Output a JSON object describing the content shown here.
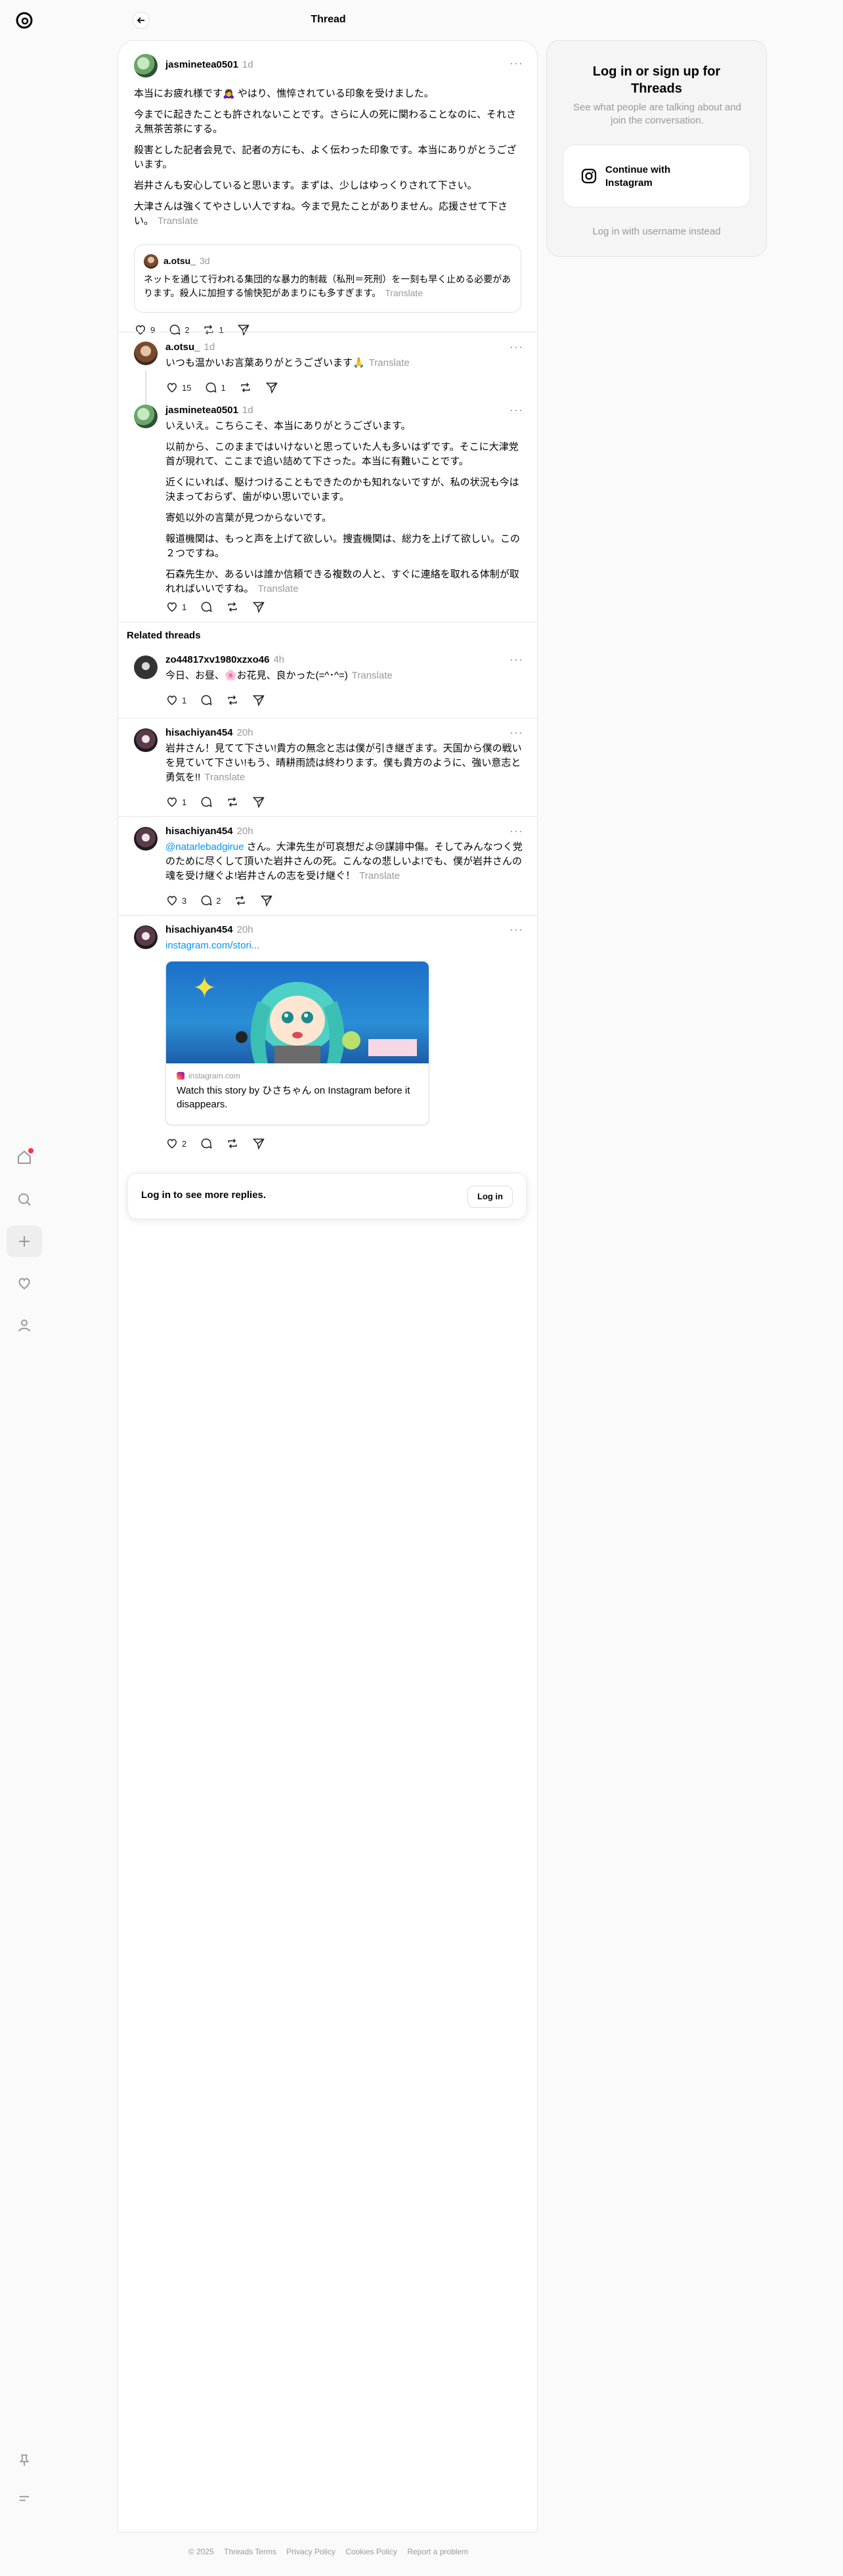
{
  "header": {
    "title": "Thread",
    "back_label": "Back"
  },
  "nav": {
    "items": [
      "home-icon",
      "search-icon",
      "create-icon",
      "activity-icon",
      "profile-icon"
    ],
    "bottom": [
      "pin-icon",
      "menu-icon"
    ]
  },
  "main_post": {
    "username": "jasminetea0501",
    "time": "1d",
    "paragraphs": [
      "本当にお疲れ様です🙇‍♀️ やはり、憔悴されている印象を受けました。",
      "今までに起きたことも許されないことです。さらに人の死に関わることなのに、それさえ無茶苦茶にする。",
      "殺害とした記者会見で、記者の方にも、よく伝わった印象です。本当にありがとうございます。",
      "岩井さんも安心していると思います。まずは、少しはゆっくりされて下さい。",
      "大津さんは強くてやさしい人ですね。今まで見たことがありません。応援させて下さい。"
    ],
    "translate": "Translate",
    "quote": {
      "username": "a.otsu_",
      "time": "3d",
      "text": "ネットを通じて行われる集団的な暴力的制裁（私刑＝死刑）を一刻も早く止める必要があります。殺人に加担する愉快犯があまりにも多すぎます。",
      "translate": "Translate"
    },
    "likes": "9",
    "replies": "2",
    "reposts": "1"
  },
  "reply1": {
    "username": "a.otsu_",
    "time": "1d",
    "text": "いつも温かいお言葉ありがとうございます🙏",
    "translate": "Translate",
    "likes": "15",
    "replies": "1"
  },
  "reply2": {
    "username": "jasminetea0501",
    "time": "1d",
    "paragraphs": [
      "いえいえ。こちらこそ、本当にありがとうございます。",
      "以前から、このままではいけないと思っていた人も多いはずです。そこに大津党首が現れて、ここまで追い詰めて下さった。本当に有難いことです。",
      "近くにいれば、駆けつけることもできたのかも知れないですが、私の状況も今は決まっておらず、歯がゆい思いでいます。",
      "寄処以外の言葉が見つからないです。",
      "報道機関は、もっと声を上げて欲しい。捜査機関は、総力を上げて欲しい。この２つですね。",
      "石森先生か、あるいは誰か信頼できる複数の人と、すぐに連絡を取れる体制が取れればいいですね。"
    ],
    "translate": "Translate",
    "likes": "1"
  },
  "related": {
    "title": "Related threads",
    "threads": [
      {
        "username": "zo44817xv1980xzxo46",
        "time": "4h",
        "text": "今日、お昼、🌸お花見、良かった(=^･^=)",
        "translate": "Translate",
        "likes": "1",
        "replies": ""
      },
      {
        "username": "hisachiyan454",
        "time": "20h",
        "text": "岩井さん！見てて下さい!貴方の無念と志は僕が引き継ぎます。天国から僕の戦いを見ていて下さい!もう、晴耕雨読は終わります。僕も貴方のように、強い意志と勇気を!!",
        "translate": "Translate",
        "likes": "1",
        "replies": ""
      },
      {
        "username": "hisachiyan454",
        "time": "20h",
        "mention": "@natarlebadgirue",
        "text": " さん。大津先生が可哀想だよ😢謀誹中傷。そしてみんなつく党のために尽くして頂いた岩井さんの死。こんなの悲しいよ!でも、僕が岩井さんの魂を受け継ぐよ!岩井さんの志を受け継ぐ！",
        "translate": "Translate",
        "likes": "3",
        "replies": "2"
      },
      {
        "username": "hisachiyan454",
        "time": "20h",
        "link": "instagram.com/stori...",
        "card_source": "instagram.com",
        "card_text": "Watch this story by ひさちゃん on Instagram before it disappears.",
        "likes": "2",
        "replies": ""
      }
    ]
  },
  "login_bar": {
    "text": "Log in to see more replies.",
    "button": "Log in"
  },
  "side": {
    "title": "Log in or sign up for Threads",
    "subtitle": "See what people are talking about and join the conversation.",
    "ig_button": "Continue with Instagram",
    "alt": "Log in with username instead"
  },
  "footer": {
    "links": [
      "© 2025",
      "Threads Terms",
      "Privacy Policy",
      "Cookies Policy",
      "Report a problem"
    ]
  },
  "colors": {
    "link": "#0095f6",
    "muted": "#999999",
    "notify": "#ff3040"
  }
}
